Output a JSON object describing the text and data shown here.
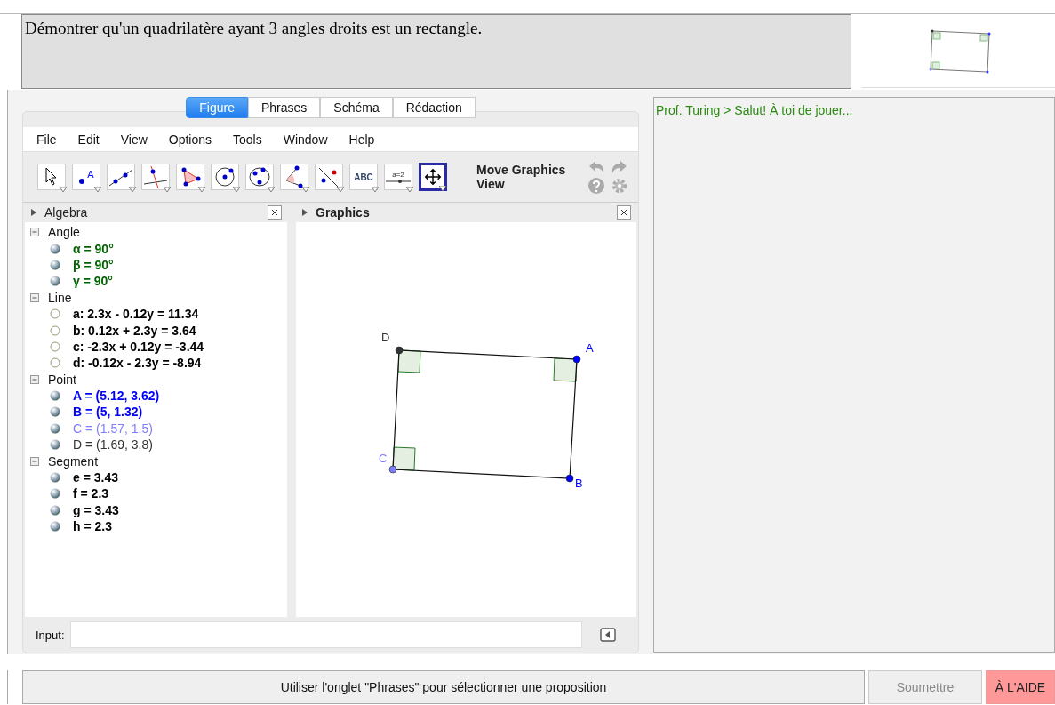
{
  "problem": {
    "statement": "Démontrer qu'un quadrilatère ayant 3 angles droits est un rectangle."
  },
  "tabs": [
    {
      "label": "Figure",
      "selected": true
    },
    {
      "label": "Phrases",
      "selected": false
    },
    {
      "label": "Schéma",
      "selected": false
    },
    {
      "label": "Rédaction",
      "selected": false
    }
  ],
  "menu": [
    "File",
    "Edit",
    "View",
    "Options",
    "Tools",
    "Window",
    "Help"
  ],
  "tools": [
    {
      "selected": false
    },
    {
      "text": "A",
      "selected": false
    },
    {
      "selected": false
    },
    {
      "selected": false
    },
    {
      "selected": false
    },
    {
      "selected": false
    },
    {
      "selected": false
    },
    {
      "selected": false
    },
    {
      "selected": false
    },
    {
      "text": "ABC",
      "selected": false
    },
    {
      "text": "a=2",
      "selected": false
    },
    {
      "selected": true
    }
  ],
  "tool_name": "Move Graphics View",
  "algebra": {
    "title": "Algebra",
    "groups": [
      {
        "name": "Angle",
        "expanded": true,
        "items": [
          {
            "text": "α = 90°",
            "color": "#006400",
            "visible": true,
            "bold": true
          },
          {
            "text": "β = 90°",
            "color": "#006400",
            "visible": true,
            "bold": true
          },
          {
            "text": "γ = 90°",
            "color": "#006400",
            "visible": true,
            "bold": true
          }
        ]
      },
      {
        "name": "Line",
        "expanded": true,
        "items": [
          {
            "text": "a: 2.3x - 0.12y = 11.34",
            "color": "#000000",
            "visible": false,
            "bold": true
          },
          {
            "text": "b: 0.12x + 2.3y = 3.64",
            "color": "#000000",
            "visible": false,
            "bold": true
          },
          {
            "text": "c: -2.3x + 0.12y = -3.44",
            "color": "#000000",
            "visible": false,
            "bold": true
          },
          {
            "text": "d: -0.12x - 2.3y = -8.94",
            "color": "#000000",
            "visible": false,
            "bold": true
          }
        ]
      },
      {
        "name": "Point",
        "expanded": true,
        "items": [
          {
            "text": "A = (5.12, 3.62)",
            "color": "#0000ff",
            "visible": true,
            "bold": true
          },
          {
            "text": "B = (5, 1.32)",
            "color": "#0000ff",
            "visible": true,
            "bold": true
          },
          {
            "text": "C = (1.57, 1.5)",
            "color": "#7d7dff",
            "visible": true,
            "bold": false
          },
          {
            "text": "D = (1.69, 3.8)",
            "color": "#333333",
            "visible": true,
            "bold": false
          }
        ]
      },
      {
        "name": "Segment",
        "expanded": true,
        "items": [
          {
            "text": "e = 3.43",
            "color": "#000000",
            "visible": true,
            "bold": true
          },
          {
            "text": "f = 2.3",
            "color": "#000000",
            "visible": true,
            "bold": true
          },
          {
            "text": "g = 3.43",
            "color": "#000000",
            "visible": true,
            "bold": true
          },
          {
            "text": "h = 2.3",
            "color": "#000000",
            "visible": true,
            "bold": true
          }
        ]
      }
    ]
  },
  "graphics": {
    "title": "Graphics",
    "points": [
      {
        "label": "D",
        "color": "#333333"
      },
      {
        "label": "A",
        "color": "#0000ff"
      },
      {
        "label": "C",
        "color": "#7d7dff"
      },
      {
        "label": "B",
        "color": "#0000ff"
      }
    ]
  },
  "input": {
    "label": "Input:"
  },
  "chat": [
    {
      "speaker": "Prof. Turing >",
      "message": "Salut! À toi de jouer..."
    }
  ],
  "status": "Utiliser l'onglet \"Phrases\" pour sélectionner une proposition",
  "submit": {
    "label": "Soumettre",
    "disabled": true
  },
  "help": {
    "label": "À L'AIDE"
  }
}
